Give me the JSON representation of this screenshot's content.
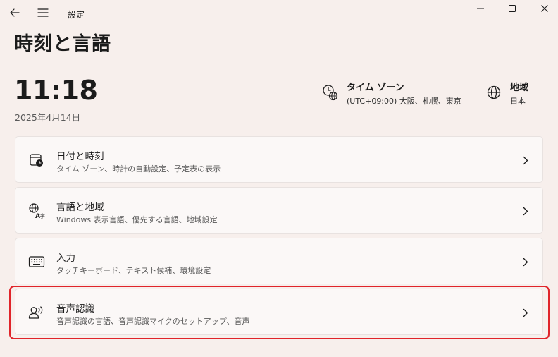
{
  "window": {
    "app_title": "設定",
    "back_icon": "back-arrow-icon",
    "menu_icon": "hamburger-menu-icon"
  },
  "page": {
    "title": "時刻と言語"
  },
  "time": {
    "clock": "11:18",
    "date": "2025年4月14日"
  },
  "timezone": {
    "title": "タイム ゾーン",
    "value": "(UTC+09:00) 大阪、札幌、東京"
  },
  "region": {
    "title": "地域",
    "value": "日本"
  },
  "cards": [
    {
      "title": "日付と時刻",
      "subtitle": "タイム ゾーン、時計の自動設定、予定表の表示",
      "icon": "calendar-clock-icon"
    },
    {
      "title": "言語と地域",
      "subtitle": "Windows 表示言語、優先する言語、地域設定",
      "icon": "language-icon"
    },
    {
      "title": "入力",
      "subtitle": "タッチキーボード、テキスト候補、環境設定",
      "icon": "keyboard-icon"
    },
    {
      "title": "音声認識",
      "subtitle": "音声認識の言語、音声認識マイクのセットアップ、音声",
      "icon": "speech-icon"
    }
  ],
  "colors": {
    "background": "#f7efec",
    "card": "#fbf8f7",
    "highlight": "#e0242a"
  }
}
